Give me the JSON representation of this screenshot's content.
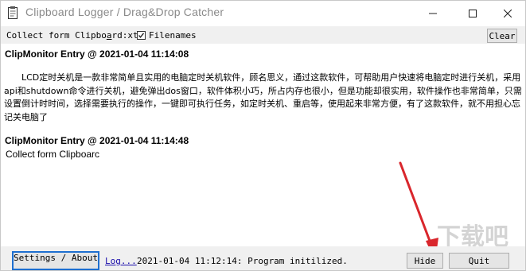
{
  "window": {
    "title": "Clipboard Logger / Drag&Drop Catcher",
    "icons": {
      "app": "clipboard-icon",
      "minimize": "minimize-icon",
      "maximize": "maximize-icon",
      "close": "close-icon"
    }
  },
  "toolbar": {
    "collect_label_pre": "Collect form Clipbo",
    "collect_label_ul": "a",
    "collect_label_mid": "rd",
    "collect_label_post": ":xt",
    "filenames_label": "Filenames",
    "filenames_checked": true,
    "clear_label": "Clear"
  },
  "log": {
    "entries": [
      {
        "header": "ClipMonitor Entry @ 2021-01-04 11:14:08",
        "body": "LCD定时关机是一款非常简单且实用的电脑定时关机软件，顾名思义，通过这款软件，可帮助用户快速将电脑定时进行关机，采用api和shutdown命令进行关机，避免弹出dos窗口，软件体积小巧，所占内存也很小，但是功能却很实用，软件操作也非常简单，只需设置倒计时时间，选择需要执行的操作，一键即可执行任务，如定时关机、重启等，使用起来非常方便，有了这款软件，就不用担心忘记关电脑了"
      },
      {
        "header": "ClipMonitor Entry @ 2021-01-04 11:14:48",
        "body": "Collect form Clipboarc"
      }
    ]
  },
  "watermark": "下载吧",
  "statusbar": {
    "settings_label": "Settings / About",
    "log_link": "Log...",
    "status_text": "2021-01-04 11:12:14: Program initilized.",
    "hide_label": "Hide",
    "quit_label": "Quit"
  },
  "colors": {
    "accent": "#1e6fd0",
    "arrow": "#d9262c",
    "link": "#1a0dab"
  }
}
